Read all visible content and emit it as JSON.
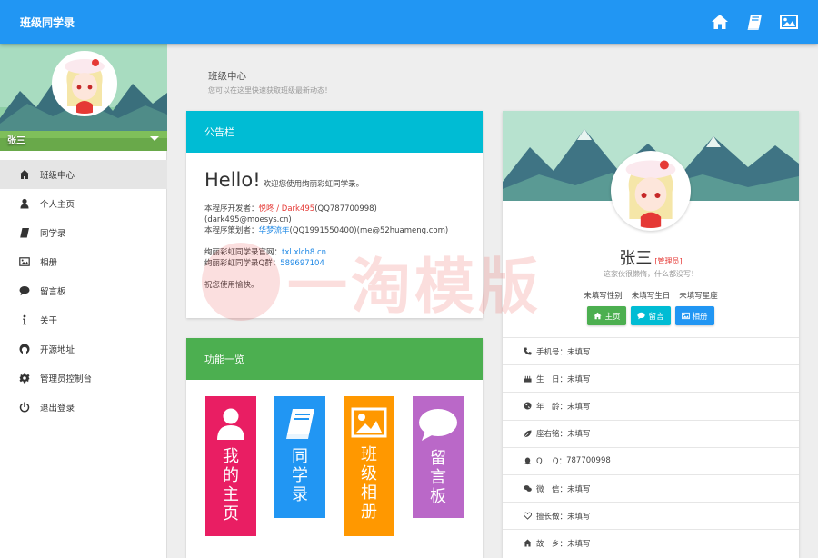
{
  "topbar": {
    "title": "班级同学录",
    "icons": [
      "home-icon",
      "book-icon",
      "image-icon"
    ]
  },
  "sidebar": {
    "username": "张三",
    "items": [
      {
        "label": "班级中心",
        "icon": "home-icon",
        "active": true
      },
      {
        "label": "个人主页",
        "icon": "user-icon"
      },
      {
        "label": "同学录",
        "icon": "book-icon"
      },
      {
        "label": "相册",
        "icon": "image-icon"
      },
      {
        "label": "留言板",
        "icon": "comment-icon"
      },
      {
        "label": "关于",
        "icon": "info-icon"
      },
      {
        "label": "开源地址",
        "icon": "github-icon"
      },
      {
        "label": "管理员控制台",
        "icon": "gear-icon"
      },
      {
        "label": "退出登录",
        "icon": "power-icon"
      }
    ]
  },
  "page": {
    "title": "班级中心",
    "subtitle": "您可以在这里快速获取班级最新动态！"
  },
  "notice": {
    "header": "公告栏",
    "hello": "Hello!",
    "welcome": "欢迎您使用绚丽彩虹同学录。",
    "dev_label": "本程序开发者：",
    "dev_names": "悦咚 / Dark495",
    "dev_qq": "(QQ787700998)",
    "dev_email": "(dark495@moesys.cn)",
    "planner_label": "本程序策划者：",
    "planner_name": "华梦流年",
    "planner_contact": "(QQ1991550400)(me@52huameng.com)",
    "site_label": "绚丽彩虹同学录官网：",
    "site_url": "txl.xlch8.cn",
    "group_label": "绚丽彩虹同学录Q群：",
    "group_no": "589697104",
    "closing": "祝您使用愉快。"
  },
  "features": {
    "header": "功能一览",
    "tiles": [
      {
        "label": "我的主页",
        "icon": "user-icon",
        "color": "#e91e63"
      },
      {
        "label": "同学录",
        "icon": "book-icon",
        "color": "#2196f3"
      },
      {
        "label": "班级相册",
        "icon": "image-icon",
        "color": "#ff9800"
      },
      {
        "label": "留言板",
        "icon": "comment-icon",
        "color": "#ba68c8"
      }
    ]
  },
  "profile": {
    "name": "张三",
    "badge": "[管理员]",
    "motto": "这家伙很懒惰，什么都没写！",
    "tags": [
      "未填写性别",
      "未填写生日",
      "未填写星座"
    ],
    "buttons": [
      {
        "label": "主页",
        "icon": "home-icon"
      },
      {
        "label": "留言",
        "icon": "comment-icon"
      },
      {
        "label": "相册",
        "icon": "image-icon"
      }
    ],
    "info": [
      {
        "label": "手机号：",
        "value": "未填写",
        "icon": "phone-icon"
      },
      {
        "label": "生　日：",
        "value": "未填写",
        "icon": "cake-icon"
      },
      {
        "label": "年　龄：",
        "value": "未填写",
        "icon": "globe-icon"
      },
      {
        "label": "座右铭：",
        "value": "未填写",
        "icon": "leaf-icon"
      },
      {
        "label": "Q　 Q：",
        "value": "787700998",
        "icon": "qq-icon"
      },
      {
        "label": "微　信：",
        "value": "未填写",
        "icon": "wechat-icon"
      },
      {
        "label": "擅长做：",
        "value": "未填写",
        "icon": "heart-icon"
      },
      {
        "label": "故　乡：",
        "value": "未填写",
        "icon": "home-icon"
      }
    ]
  },
  "watermark": {
    "text": "一淘模版"
  },
  "colors": {
    "primary": "#2196f3",
    "cyan": "#00bcd4",
    "green": "#4caf50",
    "pink": "#e91e63",
    "orange": "#ff9800",
    "purple": "#ba68c8",
    "red": "#e53935"
  }
}
